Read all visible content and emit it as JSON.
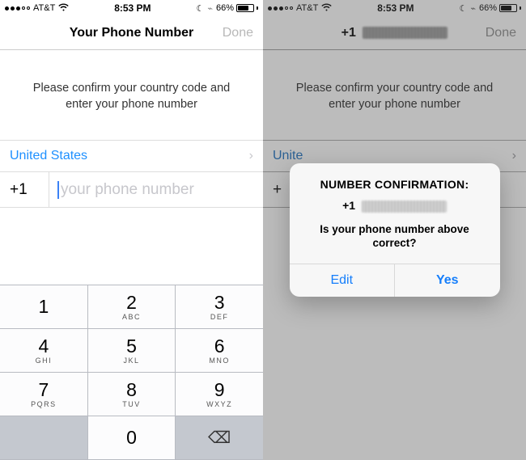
{
  "statusbar": {
    "carrier": "AT&T",
    "time": "8:53 PM",
    "battery_pct": "66%",
    "battery_fill_pct": 66
  },
  "left": {
    "title": "Your Phone Number",
    "done": "Done",
    "instruction": "Please confirm your country code and enter your phone number",
    "country": "United States",
    "dial_code": "+1",
    "placeholder": "your phone number"
  },
  "right": {
    "title_prefix": "+1",
    "done": "Done",
    "instruction": "Please confirm your country code and enter your phone number",
    "country_prefix": "Unite",
    "dial_code_prefix": "+"
  },
  "alert": {
    "title": "NUMBER CONFIRMATION:",
    "number_prefix": "+1",
    "message": "Is your phone number above correct?",
    "edit": "Edit",
    "yes": "Yes"
  },
  "keypad": {
    "r1": [
      {
        "num": "1",
        "let": ""
      },
      {
        "num": "2",
        "let": "ABC"
      },
      {
        "num": "3",
        "let": "DEF"
      }
    ],
    "r2": [
      {
        "num": "4",
        "let": "GHI"
      },
      {
        "num": "5",
        "let": "JKL"
      },
      {
        "num": "6",
        "let": "MNO"
      }
    ],
    "r3": [
      {
        "num": "7",
        "let": "PQRS"
      },
      {
        "num": "8",
        "let": "TUV"
      },
      {
        "num": "9",
        "let": "WXYZ"
      }
    ],
    "zero": "0"
  }
}
